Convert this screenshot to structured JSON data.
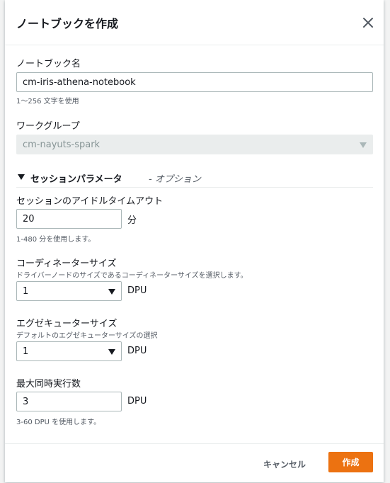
{
  "modal": {
    "title": "ノートブックを作成"
  },
  "notebook_name": {
    "label": "ノートブック名",
    "value": "cm-iris-athena-notebook",
    "hint": "1〜256 文字を使用"
  },
  "workgroup": {
    "label": "ワークグループ",
    "selected": "cm-nayuts-spark"
  },
  "session_params": {
    "title": "セッションパラメータ",
    "optional": "- オプション"
  },
  "idle_timeout": {
    "label": "セッションのアイドルタイムアウト",
    "value": "20",
    "unit": "分",
    "hint": "1-480 分を使用します。"
  },
  "coordinator_size": {
    "label": "コーディネーターサイズ",
    "description": "ドライバーノードのサイズであるコーディネーターサイズを選択します。",
    "selected": "1",
    "unit": "DPU"
  },
  "executor_size": {
    "label": "エグゼキューターサイズ",
    "description": "デフォルトのエグゼキューターサイズの選択",
    "selected": "1",
    "unit": "DPU"
  },
  "max_concurrent": {
    "label": "最大同時実行数",
    "value": "3",
    "unit": "DPU",
    "hint": "3-60 DPU を使用します。"
  },
  "footer": {
    "cancel_label": "キャンセル",
    "create_label": "作成"
  },
  "colors": {
    "primary": "#ec7211",
    "border": "#aab7b8",
    "text": "#16191f",
    "muted": "#545b64"
  }
}
